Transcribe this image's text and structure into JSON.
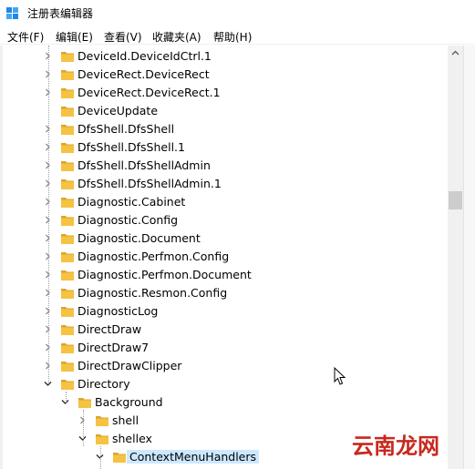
{
  "window": {
    "title": "注册表编辑器"
  },
  "menu": [
    {
      "label": "文件(F)"
    },
    {
      "label": "编辑(E)"
    },
    {
      "label": "查看(V)"
    },
    {
      "label": "收藏夹(A)"
    },
    {
      "label": "帮助(H)"
    }
  ],
  "tree": [
    {
      "label": "DeviceId.DeviceIdCtrl.1",
      "expander": "collapsed"
    },
    {
      "label": "DeviceRect.DeviceRect",
      "expander": "collapsed"
    },
    {
      "label": "DeviceRect.DeviceRect.1",
      "expander": "collapsed"
    },
    {
      "label": "DeviceUpdate",
      "expander": "none"
    },
    {
      "label": "DfsShell.DfsShell",
      "expander": "collapsed"
    },
    {
      "label": "DfsShell.DfsShell.1",
      "expander": "collapsed"
    },
    {
      "label": "DfsShell.DfsShellAdmin",
      "expander": "collapsed"
    },
    {
      "label": "DfsShell.DfsShellAdmin.1",
      "expander": "collapsed"
    },
    {
      "label": "Diagnostic.Cabinet",
      "expander": "collapsed"
    },
    {
      "label": "Diagnostic.Config",
      "expander": "collapsed"
    },
    {
      "label": "Diagnostic.Document",
      "expander": "collapsed"
    },
    {
      "label": "Diagnostic.Perfmon.Config",
      "expander": "collapsed"
    },
    {
      "label": "Diagnostic.Perfmon.Document",
      "expander": "collapsed"
    },
    {
      "label": "Diagnostic.Resmon.Config",
      "expander": "collapsed"
    },
    {
      "label": "DiagnosticLog",
      "expander": "collapsed"
    },
    {
      "label": "DirectDraw",
      "expander": "collapsed"
    },
    {
      "label": "DirectDraw7",
      "expander": "collapsed"
    },
    {
      "label": "DirectDrawClipper",
      "expander": "collapsed"
    },
    {
      "label": "Directory",
      "expander": "expanded"
    },
    {
      "label": "Background",
      "expander": "expanded"
    },
    {
      "label": "shell",
      "expander": "collapsed"
    },
    {
      "label": "shellex",
      "expander": "expanded"
    },
    {
      "label": "ContextMenuHandlers",
      "expander": "expanded",
      "selected": true
    }
  ],
  "watermark": {
    "text": "云南龙网"
  },
  "colors": {
    "folder": "#f5c242",
    "folder_dark": "#dca52c",
    "selection": "#cce8ff",
    "watermark": "#c8281e",
    "scroll_thumb": "#cdcdcd"
  }
}
